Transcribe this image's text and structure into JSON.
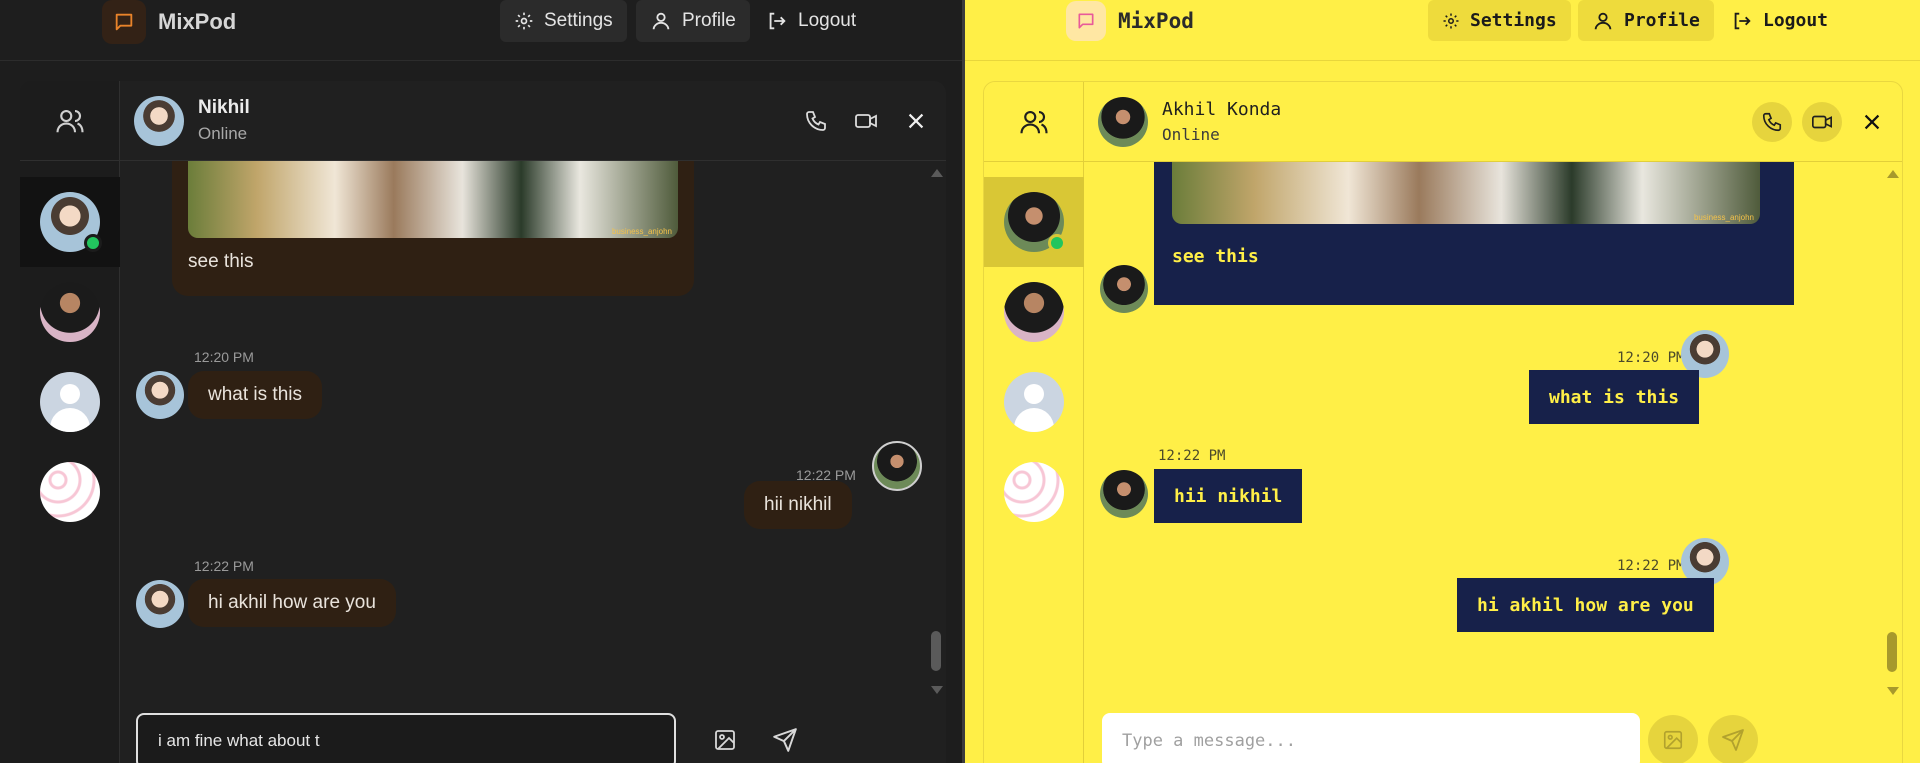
{
  "app": {
    "name": "MixPod",
    "nav": {
      "settings": "Settings",
      "profile": "Profile",
      "logout": "Logout"
    }
  },
  "left": {
    "header": {
      "name": "Nikhil",
      "status": "Online"
    },
    "messages": [
      {
        "text": "see this",
        "side": "received",
        "has_image": true,
        "image_caption": "business_anjohn"
      },
      {
        "time": "12:20 PM",
        "text": "what is this",
        "side": "received"
      },
      {
        "time": "12:22 PM",
        "text": "hii nikhil",
        "side": "sent"
      },
      {
        "time": "12:22 PM",
        "text": "hi akhil how are you",
        "side": "received"
      }
    ],
    "composer": {
      "value": "i am fine what about t",
      "placeholder": "Type a message..."
    }
  },
  "right": {
    "header": {
      "name": "Akhil Konda",
      "status": "Online"
    },
    "messages": [
      {
        "text": "see this",
        "side": "received",
        "has_image": true,
        "image_caption": "business_anjohn"
      },
      {
        "time": "12:20 PM",
        "text": "what is this",
        "side": "sent"
      },
      {
        "time": "12:22 PM",
        "text": "hii nikhil",
        "side": "received"
      },
      {
        "time": "12:22 PM",
        "text": "hi akhil how are you",
        "side": "sent"
      }
    ],
    "composer": {
      "value": "",
      "placeholder": "Type a message..."
    }
  },
  "theme": {
    "dark_bg": "#1d1d1d",
    "dark_bubble": "#2f2013",
    "accent_orange": "#e8832a",
    "yellow_bg": "#ffef47",
    "navy_bubble": "#17214a",
    "online": "#22c55e"
  },
  "icons": [
    "chat-icon",
    "gear-icon",
    "user-icon",
    "logout-icon",
    "users-icon",
    "phone-icon",
    "video-icon",
    "close-icon",
    "image-icon",
    "send-icon"
  ]
}
